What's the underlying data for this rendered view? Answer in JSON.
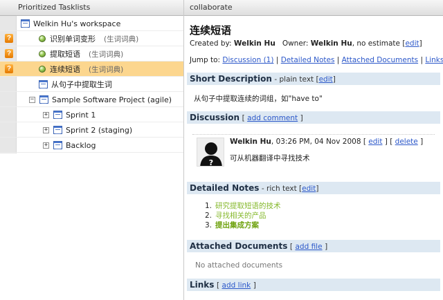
{
  "left_pane": {
    "header": "Prioritized Tasklists",
    "tree": [
      {
        "label": "Welkin Hu's workspace",
        "sub": "",
        "icon": "list-icon"
      },
      {
        "label": "识别单词变形",
        "sub": "(生词词典)",
        "icon": "status-ball-icon",
        "badge": "?"
      },
      {
        "label": "提取短语",
        "sub": "(生词词典)",
        "icon": "status-ball-icon",
        "badge": "?"
      },
      {
        "label": "连续短语",
        "sub": "(生词词典)",
        "icon": "status-ball-icon",
        "badge": "?",
        "selected": true
      },
      {
        "label": "从句子中提取生词",
        "sub": "",
        "icon": "list-icon"
      },
      {
        "label": "Sample Software Project (agile)",
        "sub": "",
        "icon": "list-icon",
        "toggle": "−"
      },
      {
        "label": "Sprint 1",
        "sub": "",
        "icon": "list-icon",
        "toggle": "+"
      },
      {
        "label": "Sprint 2 (staging)",
        "sub": "",
        "icon": "list-icon",
        "toggle": "+"
      },
      {
        "label": "Backlog",
        "sub": "",
        "icon": "list-icon",
        "toggle": "+"
      }
    ]
  },
  "right_pane": {
    "header": "collaborate",
    "title": "连续短语",
    "meta": {
      "created_by_label": "Created by:",
      "creator": "Welkin Hu",
      "owner_label": "Owner:",
      "owner": "Welkin Hu",
      "estimate_text": ", no estimate [",
      "edit": "edit",
      "close_bracket": "]"
    },
    "jump": {
      "label": "Jump to:",
      "links": [
        "Discussion (1)",
        "Detailed Notes",
        "Attached Documents",
        "Links"
      ],
      "sep": "|"
    },
    "short_description": {
      "title": "Short Description",
      "sub": "- plain text [",
      "edit": "edit",
      "close": "]",
      "text": "从句子中提取连续的词组，如\"have to\""
    },
    "discussion": {
      "title": "Discussion",
      "open": "[",
      "add_comment": "add comment",
      "close": "]",
      "comment": {
        "author": "Welkin Hu",
        "timestamp": ", 03:26 PM, 04 Nov 2008",
        "edit": "edit",
        "delete": "delete",
        "text": "可从机器翻译中寻找技术"
      }
    },
    "detailed_notes": {
      "title": "Detailed Notes",
      "sub": "- rich text [",
      "edit": "edit",
      "close": "]",
      "items": [
        "研究提取短语的技术",
        "寻找相关的产品",
        "提出集成方案"
      ]
    },
    "attached_documents": {
      "title": "Attached Documents",
      "open": "[",
      "add_file": "add file",
      "close": "]",
      "empty": "No attached documents"
    },
    "links_section": {
      "title": "Links",
      "open": "[",
      "add_link": "add link",
      "close": "]"
    }
  }
}
